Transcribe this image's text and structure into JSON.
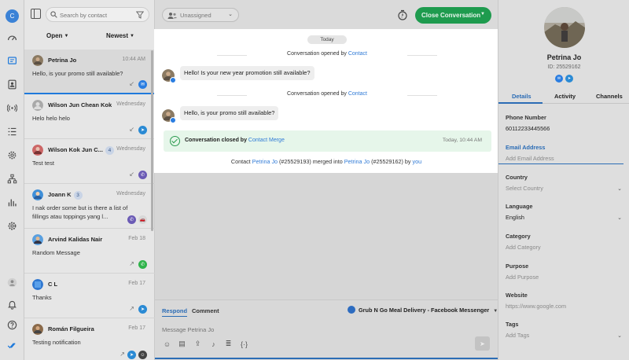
{
  "rail": {
    "user_initial": "C"
  },
  "list": {
    "search_placeholder": "Search by contact",
    "filter_status": "Open",
    "sort_order": "Newest",
    "conversations": [
      {
        "name": "Petrina Jo",
        "time": "10:44 AM",
        "preview": "Hello, is your promo still available?",
        "badge": "",
        "channel": "messenger"
      },
      {
        "name": "Wilson Jun Chean Kok",
        "time": "Wednesday",
        "preview": "Helo helo helo",
        "badge": "",
        "channel": "telegram"
      },
      {
        "name": "Wilson Kok Jun C...",
        "time": "Wednesday",
        "preview": "Test test",
        "badge": "4",
        "channel": "viber"
      },
      {
        "name": "Joann K",
        "time": "Wednesday",
        "preview": "I nak order some but is there a list of fillings atau toppings yang l...",
        "badge": "3",
        "channel": "viber"
      },
      {
        "name": "Arvind Kalidas Nair",
        "time": "Feb 18",
        "preview": "Random Message",
        "badge": "",
        "channel": "whatsapp"
      },
      {
        "name": "C L",
        "time": "Feb 17",
        "preview": "Thanks",
        "badge": "",
        "channel": "telegram"
      },
      {
        "name": "Román Filgueira",
        "time": "Feb 17",
        "preview": "Testing notification",
        "badge": "",
        "channel": "telegram"
      }
    ]
  },
  "main": {
    "assignee": "Unassigned",
    "close_button": "Close Conversation",
    "day_label": "Today",
    "events": [
      {
        "text": "Conversation opened by ",
        "link": "Contact"
      },
      {
        "text": "Conversation opened by ",
        "link": "Contact"
      }
    ],
    "messages": [
      "Hello! Is your new year promotion still available?",
      "Hello, is your promo still available?"
    ],
    "closed": {
      "text": "Conversation closed by ",
      "link": "Contact Merge",
      "time": "Today, 10:44 AM"
    },
    "merged": {
      "prefix": "Contact ",
      "contact_a": "Petrina Jo",
      "id_a": " (#25529193) merged into ",
      "contact_b": "Petrina Jo",
      "id_b": " (#25529162) by ",
      "by": "you"
    }
  },
  "composer": {
    "tab_respond": "Respond",
    "tab_comment": "Comment",
    "channel": "Grub N Go Meal Delivery - Facebook Messenger",
    "placeholder": "Message Petrina Jo"
  },
  "profile": {
    "name": "Petrina Jo",
    "id": "ID: 25529162",
    "tabs": [
      "Details",
      "Activity",
      "Channels"
    ],
    "fields": [
      {
        "label": "Phone Number",
        "value": "60112233445566",
        "placeholder": false
      },
      {
        "label": "Email Address",
        "value": "Add Email Address",
        "placeholder": true
      },
      {
        "label": "Country",
        "value": "Select Country",
        "placeholder": true
      },
      {
        "label": "Language",
        "value": "English",
        "placeholder": false
      },
      {
        "label": "Category",
        "value": "Add Category",
        "placeholder": true
      },
      {
        "label": "Purpose",
        "value": "Add Purpose",
        "placeholder": true
      },
      {
        "label": "Website",
        "value": "https://www.google.com",
        "placeholder": true
      },
      {
        "label": "Tags",
        "value": "Add Tags",
        "placeholder": true
      }
    ]
  },
  "colors": {
    "accent": "#2b6cb5",
    "close_button": "#1e9b4e",
    "closed_banner": "#e6f6ea"
  }
}
